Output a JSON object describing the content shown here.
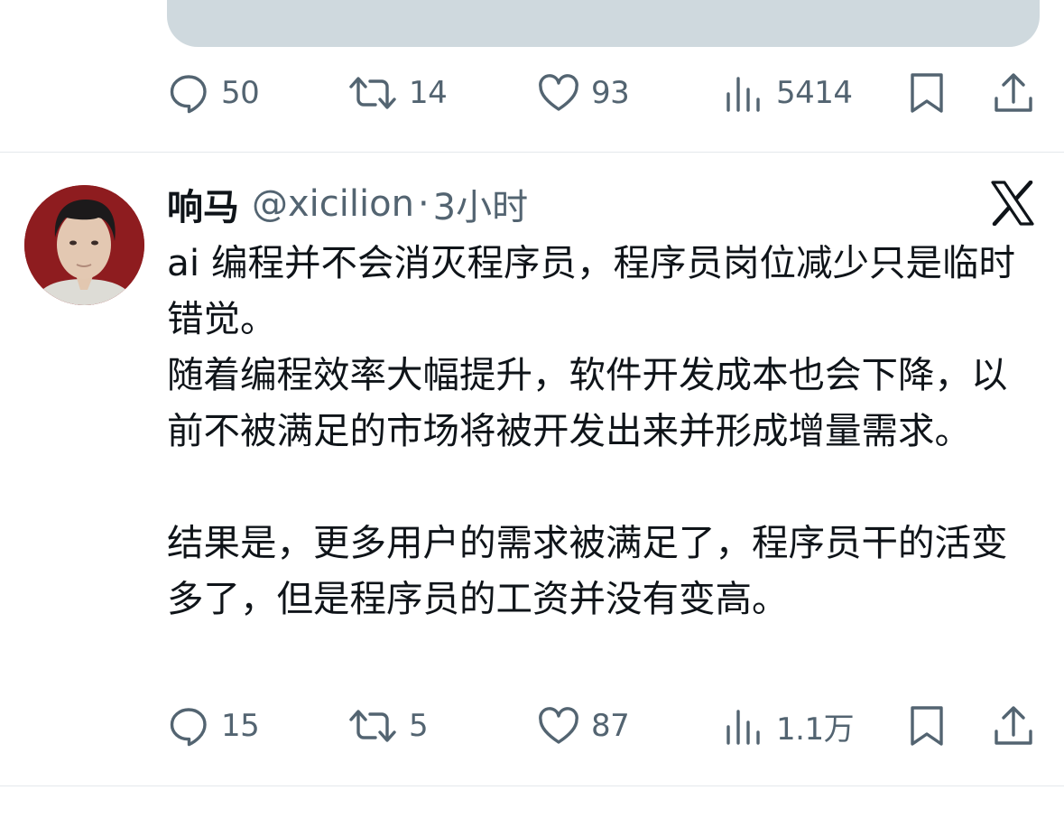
{
  "previous_tweet": {
    "actions": {
      "reply_count": "50",
      "retweet_count": "14",
      "like_count": "93",
      "view_count": "5414"
    }
  },
  "tweet": {
    "author_name": "响马",
    "handle": "@xicilion",
    "separator": "·",
    "time": "3小时",
    "paragraphs": [
      "ai 编程并不会消灭程序员，程序员岗位减少只是临时错觉。",
      "随着编程效率大幅提升，软件开发成本也会下降，以前不被满足的市场将被开发出来并形成增量需求。",
      "",
      "结果是，更多用户的需求被满足了，程序员干的活变多了，但是程序员的工资并没有变高。"
    ],
    "actions": {
      "reply_count": "15",
      "retweet_count": "5",
      "like_count": "87",
      "view_count": "1.1万"
    }
  },
  "icons": {
    "reply": "reply-icon",
    "retweet": "retweet-icon",
    "like": "heart-icon",
    "views": "views-icon",
    "bookmark": "bookmark-icon",
    "share": "share-icon",
    "platform": "x-logo-icon"
  },
  "colors": {
    "text": "#0f1419",
    "secondary": "#536471",
    "divider": "#e4e9ec",
    "media_placeholder": "#cfd9de"
  }
}
